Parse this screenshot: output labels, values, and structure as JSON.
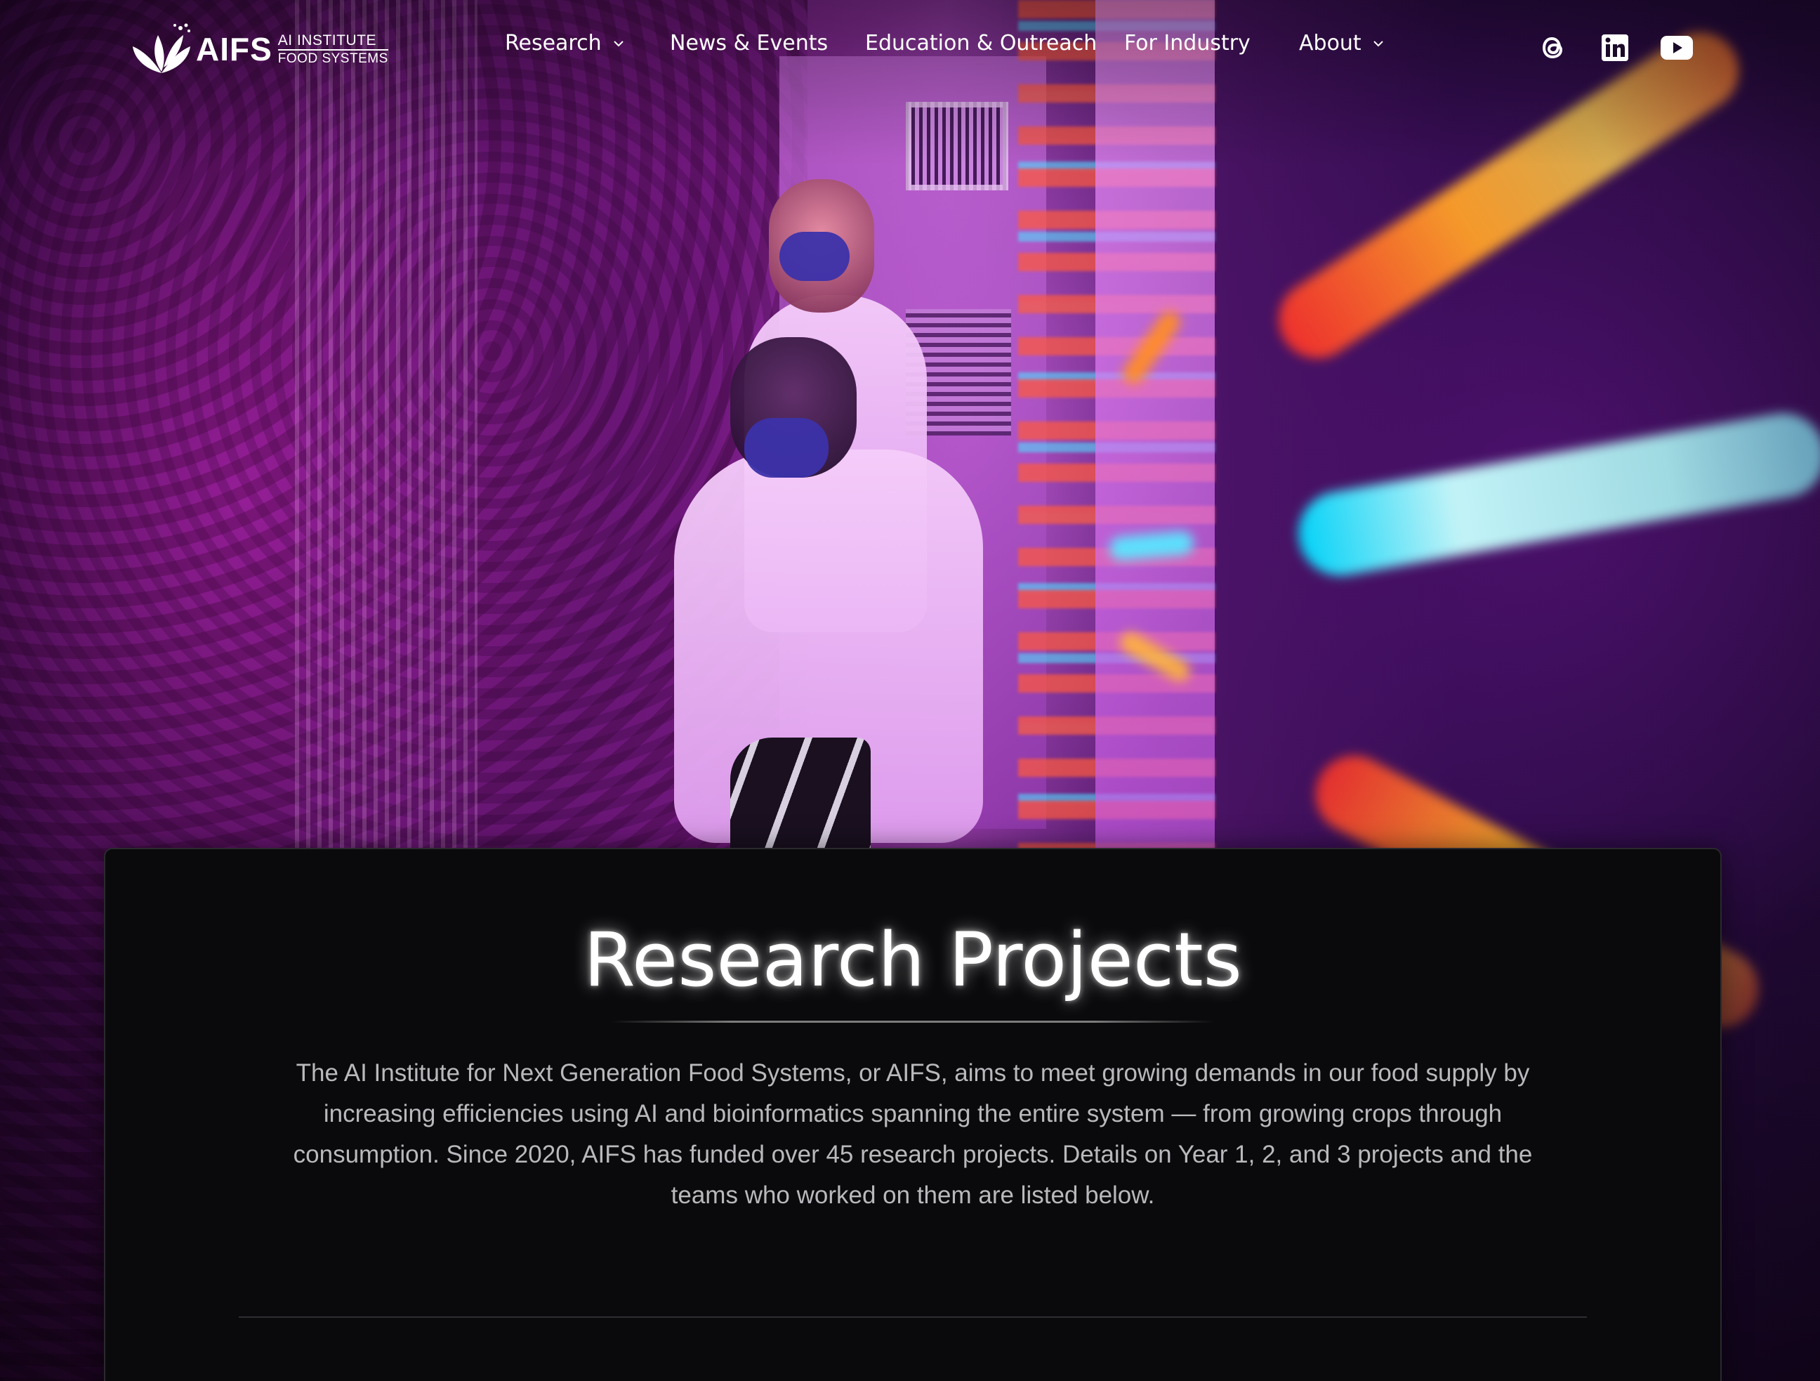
{
  "header": {
    "logo": {
      "wordmark": "AIFS",
      "line1": "AI INSTITUTE",
      "line2": "FOOD SYSTEMS",
      "icon": "leaf-logo-icon"
    },
    "nav": [
      {
        "label": "Research",
        "has_dropdown": true,
        "icon": "chevron-down-icon"
      },
      {
        "label": "News & Events",
        "has_dropdown": false
      },
      {
        "label": "Education & Outreach",
        "has_dropdown": false
      },
      {
        "label": "For Industry",
        "has_dropdown": false
      },
      {
        "label": "About",
        "has_dropdown": true,
        "icon": "chevron-down-icon"
      }
    ],
    "social": [
      {
        "icon": "threads-icon"
      },
      {
        "icon": "linkedin-icon"
      },
      {
        "icon": "youtube-icon"
      }
    ]
  },
  "hero": {
    "colors": {
      "magenta": "#a52bb2",
      "violet": "#2c0d4e",
      "orange_light": "#ff9a28",
      "cyan_light": "#50e6ff"
    }
  },
  "content": {
    "title": "Research Projects",
    "intro": "The AI Institute for Next Generation Food Systems, or AIFS, aims to meet growing demands in our food supply by increasing efficiencies using AI and bioinformatics spanning the entire system — from growing crops through consumption. Since 2020, AIFS has funded over 45 research projects. Details on Year 1, 2, and 3 projects and the teams who worked on them are listed below."
  },
  "theme": {
    "card_background": "#0a0a0c",
    "text_primary": "#ffffff",
    "text_secondary": "#b9b9bd"
  }
}
